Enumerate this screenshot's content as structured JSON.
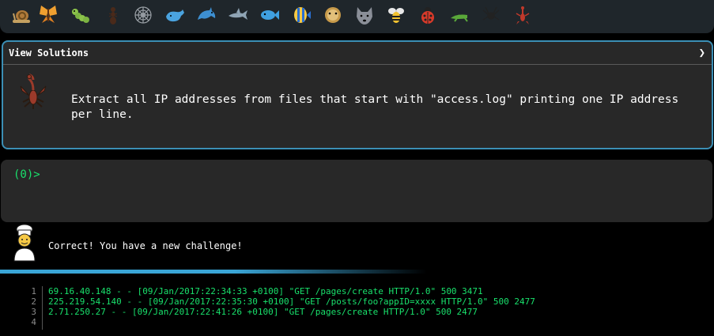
{
  "icon_bar": {
    "critters": [
      "snail-icon",
      "butterfly-icon",
      "caterpillar-icon",
      "ant-icon",
      "spider-web-icon",
      "whale-icon",
      "dolphin-icon",
      "shark-icon",
      "fish-icon",
      "tropical-fish-icon",
      "pufferfish-icon",
      "wolf-icon",
      "bee-icon",
      "ladybug-icon",
      "cricket-icon",
      "spider-icon",
      "scorpion-icon"
    ]
  },
  "panel": {
    "title": "View Solutions",
    "chevron": "❯",
    "problem": "Extract all IP addresses from files that start with \"access.log\" printing one IP address per line."
  },
  "terminal": {
    "prompt": "(0)>"
  },
  "feedback": {
    "message": "Correct! You have a new challenge!"
  },
  "output": {
    "lines": [
      {
        "num": "1",
        "text": "69.16.40.148 - - [09/Jan/2017:22:34:33 +0100] \"GET /pages/create HTTP/1.0\" 500 3471"
      },
      {
        "num": "2",
        "text": "225.219.54.140 - - [09/Jan/2017:22:35:30 +0100] \"GET /posts/foo?appID=xxxx HTTP/1.0\" 500 2477"
      },
      {
        "num": "3",
        "text": "2.71.250.27 - - [09/Jan/2017:22:41:26 +0100] \"GET /pages/create HTTP/1.0\" 500 2477"
      },
      {
        "num": "4",
        "text": ""
      }
    ]
  },
  "colors": {
    "accent": "#3b8fb5",
    "prompt_green": "#19e16c",
    "panel_bg": "#282828"
  }
}
